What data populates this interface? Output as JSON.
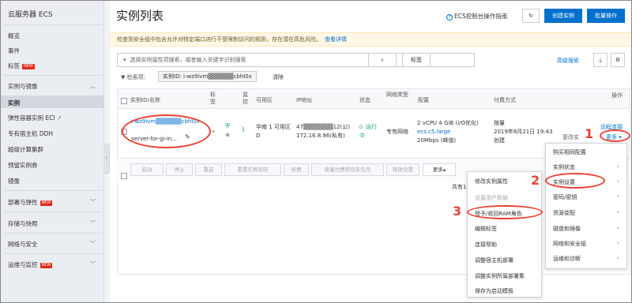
{
  "sidebar": {
    "title": "云服务器 ECS",
    "items": [
      {
        "label": "概览"
      },
      {
        "label": "事件"
      },
      {
        "label": "标签",
        "badge": "NEW"
      }
    ],
    "group": "实例与镜像",
    "sub_items": [
      {
        "label": "实例"
      },
      {
        "label": "弹性容器实例 ECI"
      },
      {
        "label": "专有宿主机 DDH"
      },
      {
        "label": "超级计算集群"
      },
      {
        "label": "预留实例券"
      },
      {
        "label": "镜像"
      }
    ],
    "groups": [
      {
        "label": "部署与弹性",
        "badge": "NEW"
      },
      {
        "label": "存储与快照"
      },
      {
        "label": "网络与安全"
      },
      {
        "label": "运维与监控",
        "badge": "NEW"
      }
    ]
  },
  "header": {
    "title": "实例列表",
    "guide": "ECS控制台操作指南",
    "create": "创建实例",
    "bulk_buy": "批量操作"
  },
  "notice": {
    "text": "检查到安全组中包含允许对特定端口进行不受限制访问的规则，存在潜在高危风险。",
    "link": "查看详情"
  },
  "search": {
    "placeholder": "选择实例属性项搜索，或者输入关键字识别搜索",
    "tag_btn": "标签",
    "advanced": "高级搜索"
  },
  "filter": {
    "label": "检索项:",
    "chip": "实例ID: i-wz9ivm▒▒▒▒▒▒cbhl0x",
    "clear": "清除"
  },
  "table": {
    "headers": [
      "实例ID/名称",
      "标签",
      "监控",
      "可用区",
      "IP地址",
      "状态",
      "网络类型",
      "配置",
      "付费方式",
      "操作"
    ],
    "row": {
      "id": "i-wz9ivm▒▒▒▒▒▒cbhl0x",
      "name": "server-for-gi-in...",
      "zone_line1": "华南 1 可用区",
      "zone_line2": "D",
      "ip_line1": "47▒▒▒▒▒▒▒12(公)",
      "ip_line2": "172.16.8.96(私有)",
      "status_line1": "运行",
      "status_line2": "中",
      "network": "专有网络",
      "config_line1": "2 vCPU 4 GiB (I/O优化)",
      "config_line2": "ecs.c5.large",
      "config_line3": "20Mbps (峰值)",
      "pay_line1": "按量",
      "pay_line2": "2019年8月21日 19:43",
      "pay_line3": "创建",
      "op_remote": "远程连接",
      "op_change": "更改实",
      "op_more": "更多"
    }
  },
  "bulk": {
    "buttons": [
      "启动",
      "停止",
      "重启",
      "重置实例密码",
      "续费",
      "按量付费转包年包月",
      "释放设置",
      "更多"
    ],
    "total": "共有1"
  },
  "menu_main": {
    "items": [
      "购买相同配置",
      "实例状态",
      "实例设置",
      "密码/密钥",
      "资源变配",
      "磁盘和镜像",
      "网络和安全组",
      "运维和诊断"
    ]
  },
  "menu_sub": {
    "items": [
      "修改实例属性",
      "设置用户数据",
      "授予/收回RAM角色",
      "编辑标签",
      "连接帮助",
      "调整宿主机部署",
      "调整实例所属部署集",
      "保存为启动模板"
    ]
  },
  "annotations": [
    "1",
    "2",
    "3"
  ]
}
